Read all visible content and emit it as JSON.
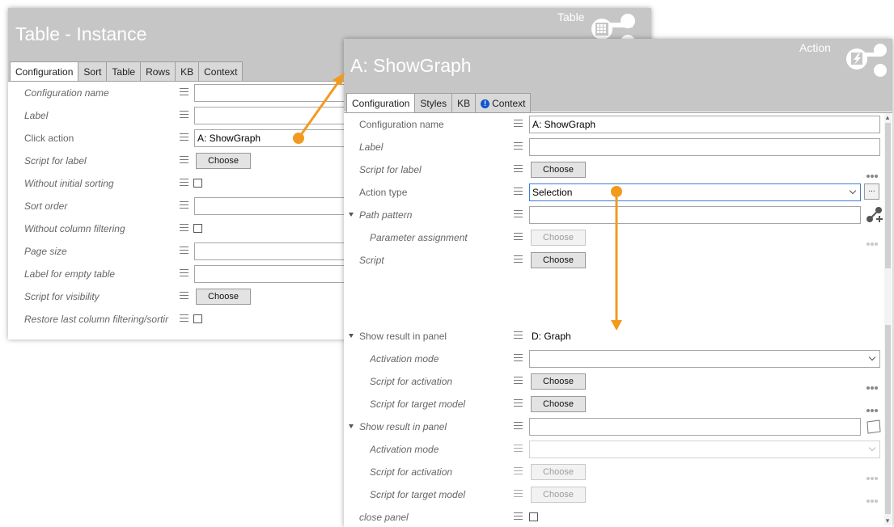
{
  "table_panel": {
    "title": "Table - Instance",
    "type_label": "Table",
    "tabs": [
      "Configuration",
      "Sort",
      "Table",
      "Rows",
      "KB",
      "Context"
    ],
    "rows": [
      {
        "label": "Configuration name",
        "control": "input",
        "value": ""
      },
      {
        "label": "Label",
        "control": "input",
        "value": ""
      },
      {
        "label": "Click action",
        "control": "input",
        "value": "A: ShowGraph"
      },
      {
        "label": "Script for label",
        "control": "button",
        "value": "Choose"
      },
      {
        "label": "Without initial sorting",
        "control": "checkbox",
        "value": ""
      },
      {
        "label": "Sort order",
        "control": "input",
        "value": ""
      },
      {
        "label": "Without column filtering",
        "control": "checkbox",
        "value": ""
      },
      {
        "label": "Page size",
        "control": "input",
        "value": ""
      },
      {
        "label": "Label for empty table",
        "control": "input",
        "value": ""
      },
      {
        "label": "Script for visibility",
        "control": "button",
        "value": "Choose"
      },
      {
        "label": "Restore last column filtering/sortir",
        "control": "checkbox",
        "value": ""
      }
    ]
  },
  "action_panel": {
    "title": "A: ShowGraph",
    "type_label": "Action",
    "tabs": [
      "Configuration",
      "Styles",
      "KB",
      "Context"
    ],
    "rows_top": [
      {
        "label": "Configuration name",
        "control": "input",
        "value": "A: ShowGraph"
      },
      {
        "label": "Label",
        "control": "input",
        "value": ""
      },
      {
        "label": "Script for label",
        "control": "button",
        "value": "Choose"
      },
      {
        "label": "Action type",
        "control": "select",
        "value": "Selection"
      },
      {
        "label": "Path pattern",
        "control": "input",
        "value": ""
      },
      {
        "label": "Parameter assignment",
        "control": "button",
        "value": "Choose"
      },
      {
        "label": "Script",
        "control": "button",
        "value": "Choose"
      }
    ],
    "rows_bottom": [
      {
        "label": "Show result in panel",
        "control": "text",
        "value": "D: Graph"
      },
      {
        "label": "Activation mode",
        "control": "select",
        "value": ""
      },
      {
        "label": "Script for activation",
        "control": "button",
        "value": "Choose"
      },
      {
        "label": "Script for target model",
        "control": "button",
        "value": "Choose"
      },
      {
        "label": "Show result in panel",
        "control": "input",
        "value": ""
      },
      {
        "label": "Activation mode",
        "control": "select",
        "value": ""
      },
      {
        "label": "Script for activation",
        "control": "button",
        "value": "Choose"
      },
      {
        "label": "Script for target model",
        "control": "button",
        "value": "Choose"
      },
      {
        "label": "close panel",
        "control": "checkbox",
        "value": ""
      }
    ]
  },
  "colors": {
    "header_bg": "#c6c6c6",
    "accent_arrow": "#f29a1f",
    "focus_border": "#3c7fd6"
  }
}
